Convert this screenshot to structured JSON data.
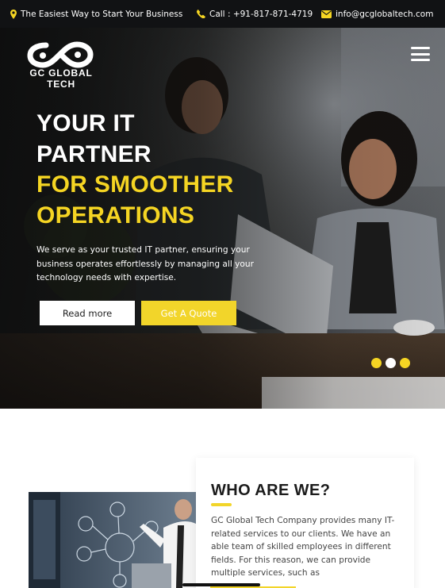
{
  "topbar": {
    "tagline": "The Easiest Way to Start Your Business",
    "phone": "Call : +91-817-871-4719",
    "email": "info@gcglobaltech.com"
  },
  "header": {
    "logo_text": "GC GLOBAL TECH"
  },
  "hero": {
    "headline_line1": "YOUR IT",
    "headline_line2": "PARTNER",
    "headline_line3": "FOR SMOOTHER",
    "headline_line4": "OPERATIONS",
    "description": "We serve as your trusted IT partner, ensuring your business operates effortlessly by managing all your technology needs with expertise.",
    "read_more_label": "Read more",
    "quote_label": "Get A Quote",
    "slides": 3,
    "active_slide": 2
  },
  "about": {
    "title": "WHO ARE WE?",
    "text": "GC Global Tech Company provides many IT-related services to our clients. We have an able team of skilled employees in different fields. For this reason, we can provide multiple services, such as"
  },
  "colors": {
    "accent": "#f5d523",
    "topbar_bg": "#111214",
    "dark": "#1b1b1b"
  },
  "icons": {
    "location": "map-pin-icon",
    "phone": "phone-icon",
    "email": "envelope-icon",
    "menu": "hamburger-menu-icon"
  }
}
